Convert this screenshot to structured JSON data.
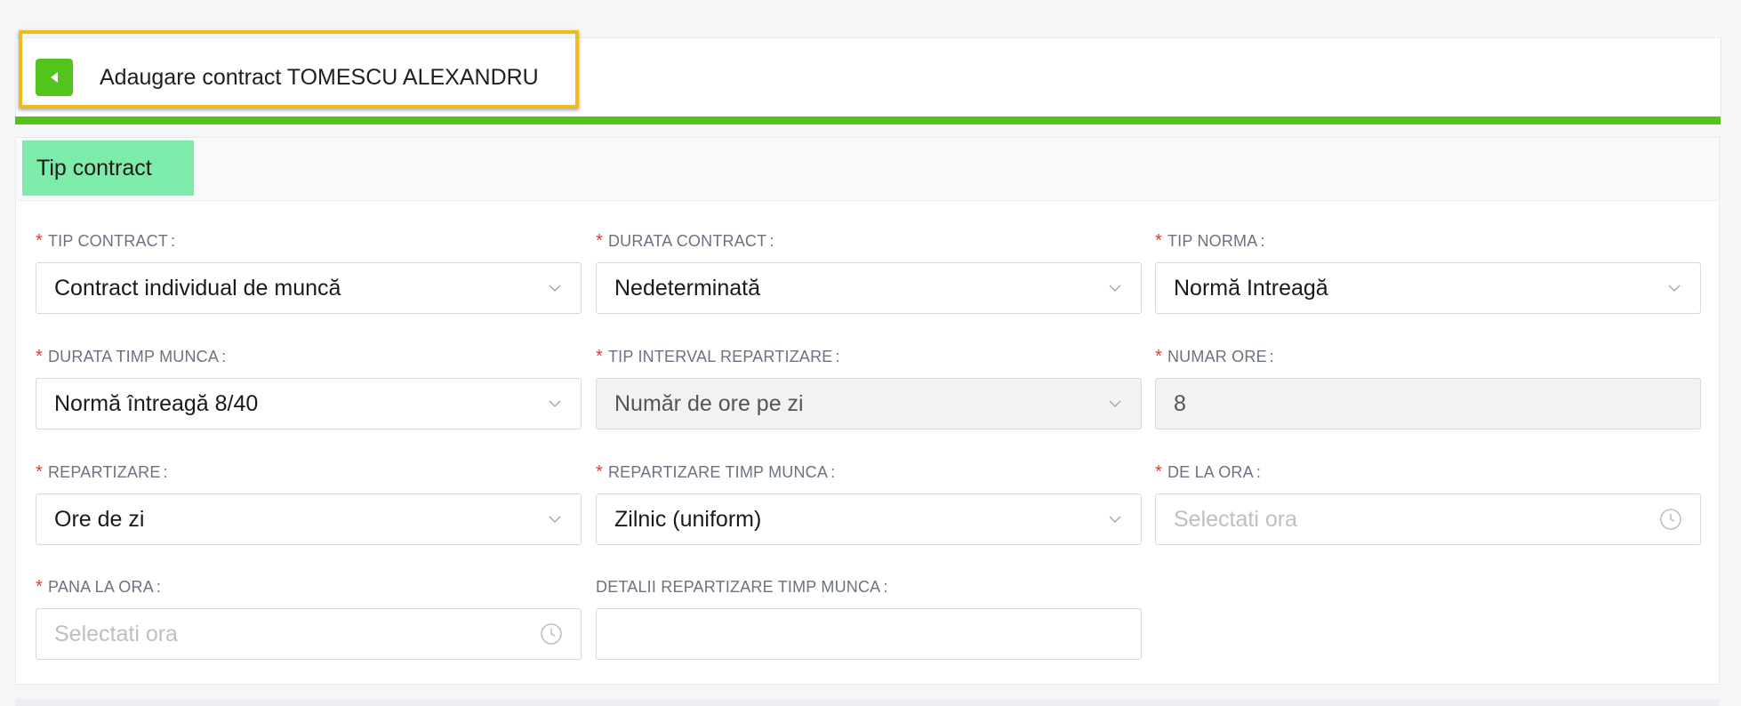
{
  "header": {
    "title": "Adaugare contract TOMESCU ALEXANDRU"
  },
  "section": {
    "tab_label": "Tip contract"
  },
  "fields": {
    "tip_contract": {
      "label": "TIP CONTRACT",
      "value": "Contract individual de muncă"
    },
    "durata_contract": {
      "label": "DURATA CONTRACT",
      "value": "Nedeterminată"
    },
    "tip_norma": {
      "label": "TIP NORMA",
      "value": "Normă Intreagă"
    },
    "durata_timp_munca": {
      "label": "DURATA TIMP MUNCA",
      "value": "Normă întreagă 8/40"
    },
    "tip_interval_repartizare": {
      "label": "TIP INTERVAL REPARTIZARE",
      "value": "Număr de ore pe zi"
    },
    "numar_ore": {
      "label": "NUMAR ORE",
      "value": "8"
    },
    "repartizare": {
      "label": "REPARTIZARE",
      "value": "Ore de zi"
    },
    "repartizare_timp_munca": {
      "label": "REPARTIZARE TIMP MUNCA",
      "value": "Zilnic (uniform)"
    },
    "de_la_ora": {
      "label": "DE LA ORA",
      "placeholder": "Selectati ora"
    },
    "pana_la_ora": {
      "label": "PANA LA ORA",
      "placeholder": "Selectati ora"
    },
    "detalii_repartizare": {
      "label": "DETALII REPARTIZARE TIMP MUNCA",
      "value": ""
    }
  },
  "common": {
    "required_marker": "*",
    "colon": ":"
  },
  "icons": {
    "back": "caret-left-icon",
    "select": "chevron-down-icon",
    "time": "clock-icon"
  },
  "colors": {
    "accent_green": "#52c41a",
    "tab_green": "#7deba9",
    "highlight": "#f0bb1c",
    "required": "#e53935"
  }
}
